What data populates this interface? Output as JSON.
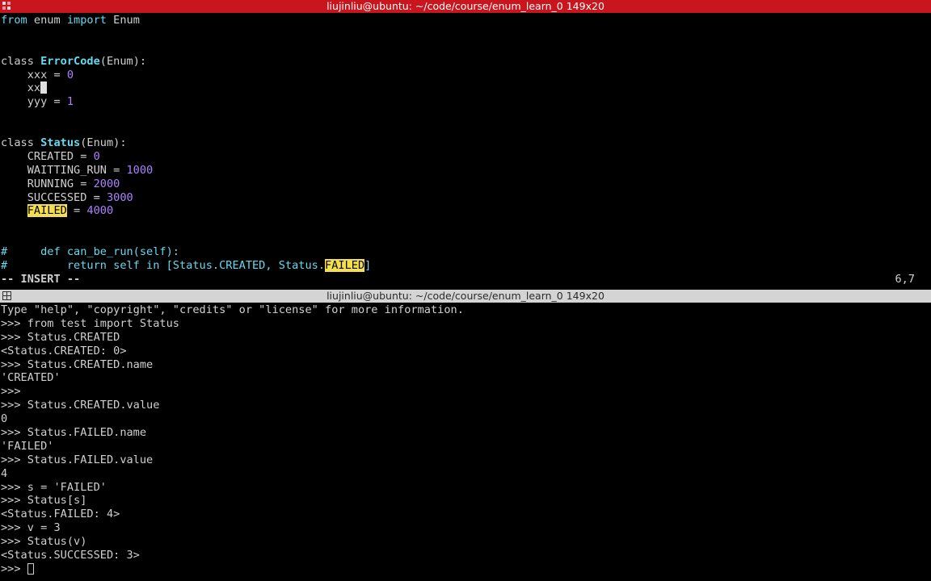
{
  "window": {
    "top_title": "liujinliu@ubuntu: ~/code/course/enum_learn_0 149x20",
    "bottom_title": "liujinliu@ubuntu: ~/code/course/enum_learn_0 149x20"
  },
  "editor": {
    "l1": {
      "a": "from",
      "b": " enum ",
      "c": "import",
      "d": " Enum"
    },
    "l4": {
      "a": "class ",
      "b": "ErrorCode",
      "c": "(Enum):"
    },
    "l5": {
      "a": "    xxx = ",
      "b": "0"
    },
    "l6": {
      "a": "    xx"
    },
    "l7": {
      "a": "    yyy = ",
      "b": "1"
    },
    "l10": {
      "a": "class ",
      "b": "Status",
      "c": "(Enum):"
    },
    "l11": {
      "a": "    CREATED = ",
      "b": "0"
    },
    "l12": {
      "a": "    WAITTING_RUN = ",
      "b": "1000"
    },
    "l13": {
      "a": "    RUNNING = ",
      "b": "2000"
    },
    "l14": {
      "a": "    SUCCESSED = ",
      "b": "3000"
    },
    "l15": {
      "a": "    ",
      "b": "FAILED",
      "c": " = ",
      "d": "4000"
    },
    "l18": {
      "a": "#     def can_be_run(self):"
    },
    "l19": {
      "a": "#         return self in [Status.CREATED, Status.",
      "b": "FAILED",
      "c": "]"
    },
    "mode": "-- INSERT --",
    "position": "6,7"
  },
  "console": {
    "lines": [
      "Type \"help\", \"copyright\", \"credits\" or \"license\" for more information.",
      ">>> from test import Status",
      ">>> Status.CREATED",
      "<Status.CREATED: 0>",
      ">>> Status.CREATED.name",
      "'CREATED'",
      ">>>",
      ">>> Status.CREATED.value",
      "0",
      ">>> Status.FAILED.name",
      "'FAILED'",
      ">>> Status.FAILED.value",
      "4",
      ">>> s = 'FAILED'",
      ">>> Status[s]",
      "<Status.FAILED: 4>",
      ">>> v = 3",
      ">>> Status(v)",
      "<Status.SUCCESSED: 3>"
    ],
    "prompt": ">>> "
  },
  "colors": {
    "top_titlebar": "#c9151e",
    "bottom_titlebar": "#d4d4d4",
    "keyword": "#66d9ef",
    "number": "#ae81ff",
    "search_highlight": "#f4e04d",
    "background": "#000000"
  },
  "icons": {
    "top_titlebar_icon": "terminal-grid-icon",
    "bottom_titlebar_icon": "terminal-grid-icon"
  }
}
